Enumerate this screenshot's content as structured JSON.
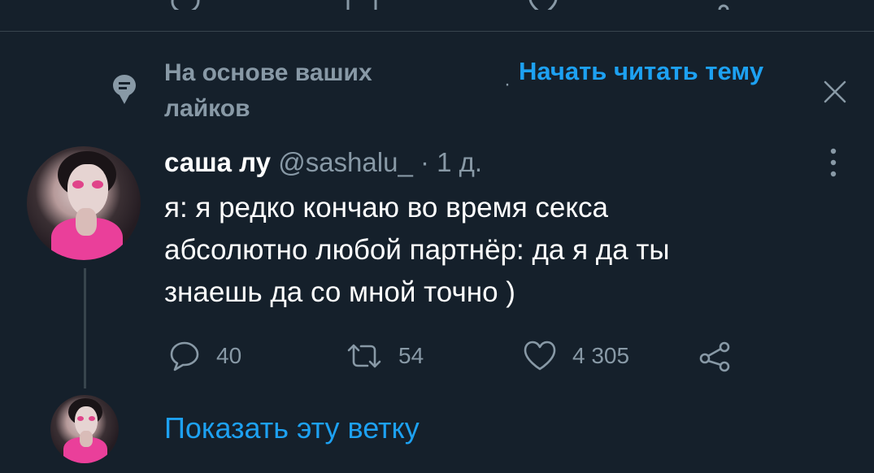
{
  "context": {
    "label": "На основе ваших лайков",
    "start_reading": "Начать читать тему",
    "separator": "·"
  },
  "tweet": {
    "author_name": "саша лу",
    "handle": "@sashalu_",
    "separator": "·",
    "timestamp": "1 д.",
    "lines": [
      "я: я редко кончаю во время секса",
      "абсолютно любой партнёр: да я да ты",
      "знаешь да со мной точно )"
    ],
    "replies": "40",
    "retweets": "54",
    "likes": "4 305"
  },
  "thread": {
    "show_thread": "Показать эту ветку"
  },
  "colors": {
    "background": "#15202b",
    "secondary_text": "#8899a6",
    "accent": "#1da1f2",
    "divider": "#38444d"
  },
  "icons": [
    "reply-icon",
    "retweet-icon",
    "like-icon",
    "share-icon",
    "speech-pin-icon",
    "close-icon",
    "more-vertical-icon"
  ]
}
